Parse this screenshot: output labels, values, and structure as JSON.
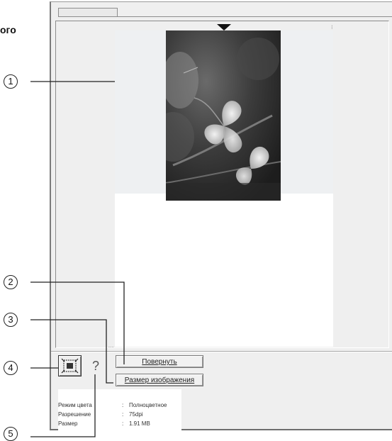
{
  "page": {
    "title_fragment": "ого"
  },
  "toolbar": {
    "rotate_label": "Повернуть",
    "image_size_label": "Размер изображения",
    "help_glyph": "?",
    "select_icon": "select-area-icon"
  },
  "info": {
    "rows": [
      {
        "key": "Режим цвета",
        "sep": ":",
        "value": "Полноцветное"
      },
      {
        "key": "Разрешение",
        "sep": ":",
        "value": "75dpi"
      },
      {
        "key": "Размер",
        "sep": ":",
        "value": "1.91 MB"
      }
    ]
  },
  "callouts": [
    "1",
    "2",
    "3",
    "4",
    "5"
  ],
  "marks": {
    "tiny": "⁝",
    "dotted": "·····"
  }
}
